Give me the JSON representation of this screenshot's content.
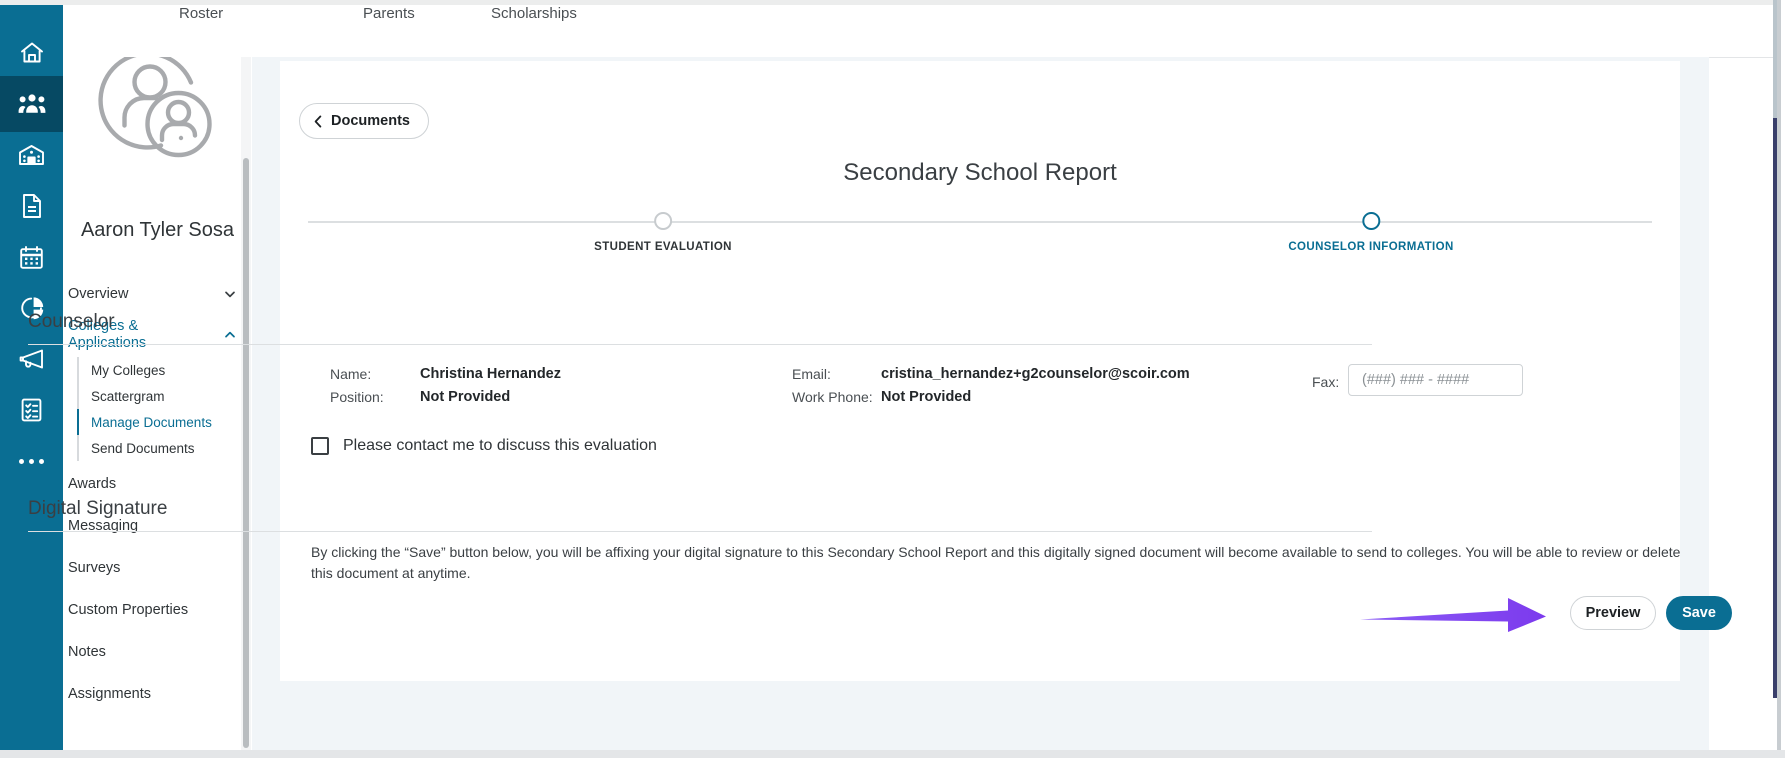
{
  "rail": {
    "items": [
      {
        "name": "home-icon",
        "label": "Home",
        "active": false
      },
      {
        "name": "students-icon",
        "label": "Students",
        "active": true
      },
      {
        "name": "school-icon",
        "label": "School",
        "active": false
      },
      {
        "name": "documents-icon",
        "label": "Documents",
        "active": false
      },
      {
        "name": "calendar-icon",
        "label": "Calendar",
        "active": false
      },
      {
        "name": "reports-icon",
        "label": "Reports",
        "active": false
      },
      {
        "name": "announcements-icon",
        "label": "Announcements",
        "active": false
      },
      {
        "name": "tasks-icon",
        "label": "Tasks",
        "active": false
      },
      {
        "name": "more-icon",
        "label": "More",
        "active": false
      }
    ]
  },
  "topbar": {
    "tabs": [
      {
        "label": "Roster"
      },
      {
        "label": "Parents"
      },
      {
        "label": "Scholarships"
      }
    ]
  },
  "student_panel": {
    "avatar_icon": "student-avatar-icon",
    "name": "Aaron Tyler Sosa",
    "nav": [
      {
        "label": "Overview",
        "expanded": false,
        "selected": false,
        "children": []
      },
      {
        "label": "Colleges & Applications",
        "expanded": true,
        "selected": true,
        "children": [
          {
            "label": "My Colleges",
            "selected": false
          },
          {
            "label": "Scattergram",
            "selected": false
          },
          {
            "label": "Manage Documents",
            "selected": true
          },
          {
            "label": "Send Documents",
            "selected": false
          }
        ]
      },
      {
        "label": "Awards",
        "expanded": false,
        "selected": false,
        "children": []
      },
      {
        "label": "Messaging",
        "expanded": false,
        "selected": false,
        "children": []
      },
      {
        "label": "Surveys",
        "expanded": false,
        "selected": false,
        "children": []
      },
      {
        "label": "Custom Properties",
        "expanded": false,
        "selected": false,
        "children": []
      },
      {
        "label": "Notes",
        "expanded": false,
        "selected": false,
        "children": []
      },
      {
        "label": "Assignments",
        "expanded": false,
        "selected": false,
        "children": []
      }
    ]
  },
  "main": {
    "back_button": "Documents",
    "title": "Secondary School Report",
    "stepper": [
      {
        "label": "STUDENT EVALUATION",
        "active": false
      },
      {
        "label": "COUNSELOR INFORMATION",
        "active": true
      }
    ],
    "counselor": {
      "heading": "Counselor",
      "name_label": "Name:",
      "name_value": "Christina Hernandez",
      "position_label": "Position:",
      "position_value": "Not Provided",
      "email_label": "Email:",
      "email_value": "cristina_hernandez+g2counselor@scoir.com",
      "work_phone_label": "Work Phone:",
      "work_phone_value": "Not Provided",
      "fax_label": "Fax:",
      "fax_value": "",
      "fax_placeholder": "(###) ### - ####"
    },
    "contact_checkbox": {
      "label": "Please contact me to discuss this evaluation",
      "checked": false
    },
    "digital_signature": {
      "heading": "Digital Signature",
      "body": "By clicking the “Save” button below, you will be affixing your digital signature to this Secondary School Report and this digitally signed document will become available to send to colleges. You will be able to review or delete this document at anytime."
    },
    "actions": {
      "preview_label": "Preview",
      "save_label": "Save"
    }
  },
  "colors": {
    "rail": "#0a6e93",
    "rail_active": "#064963",
    "accent": "#0a6e93",
    "content_bg": "#f1f5f8",
    "annotation_arrow": "#7c3aed"
  }
}
